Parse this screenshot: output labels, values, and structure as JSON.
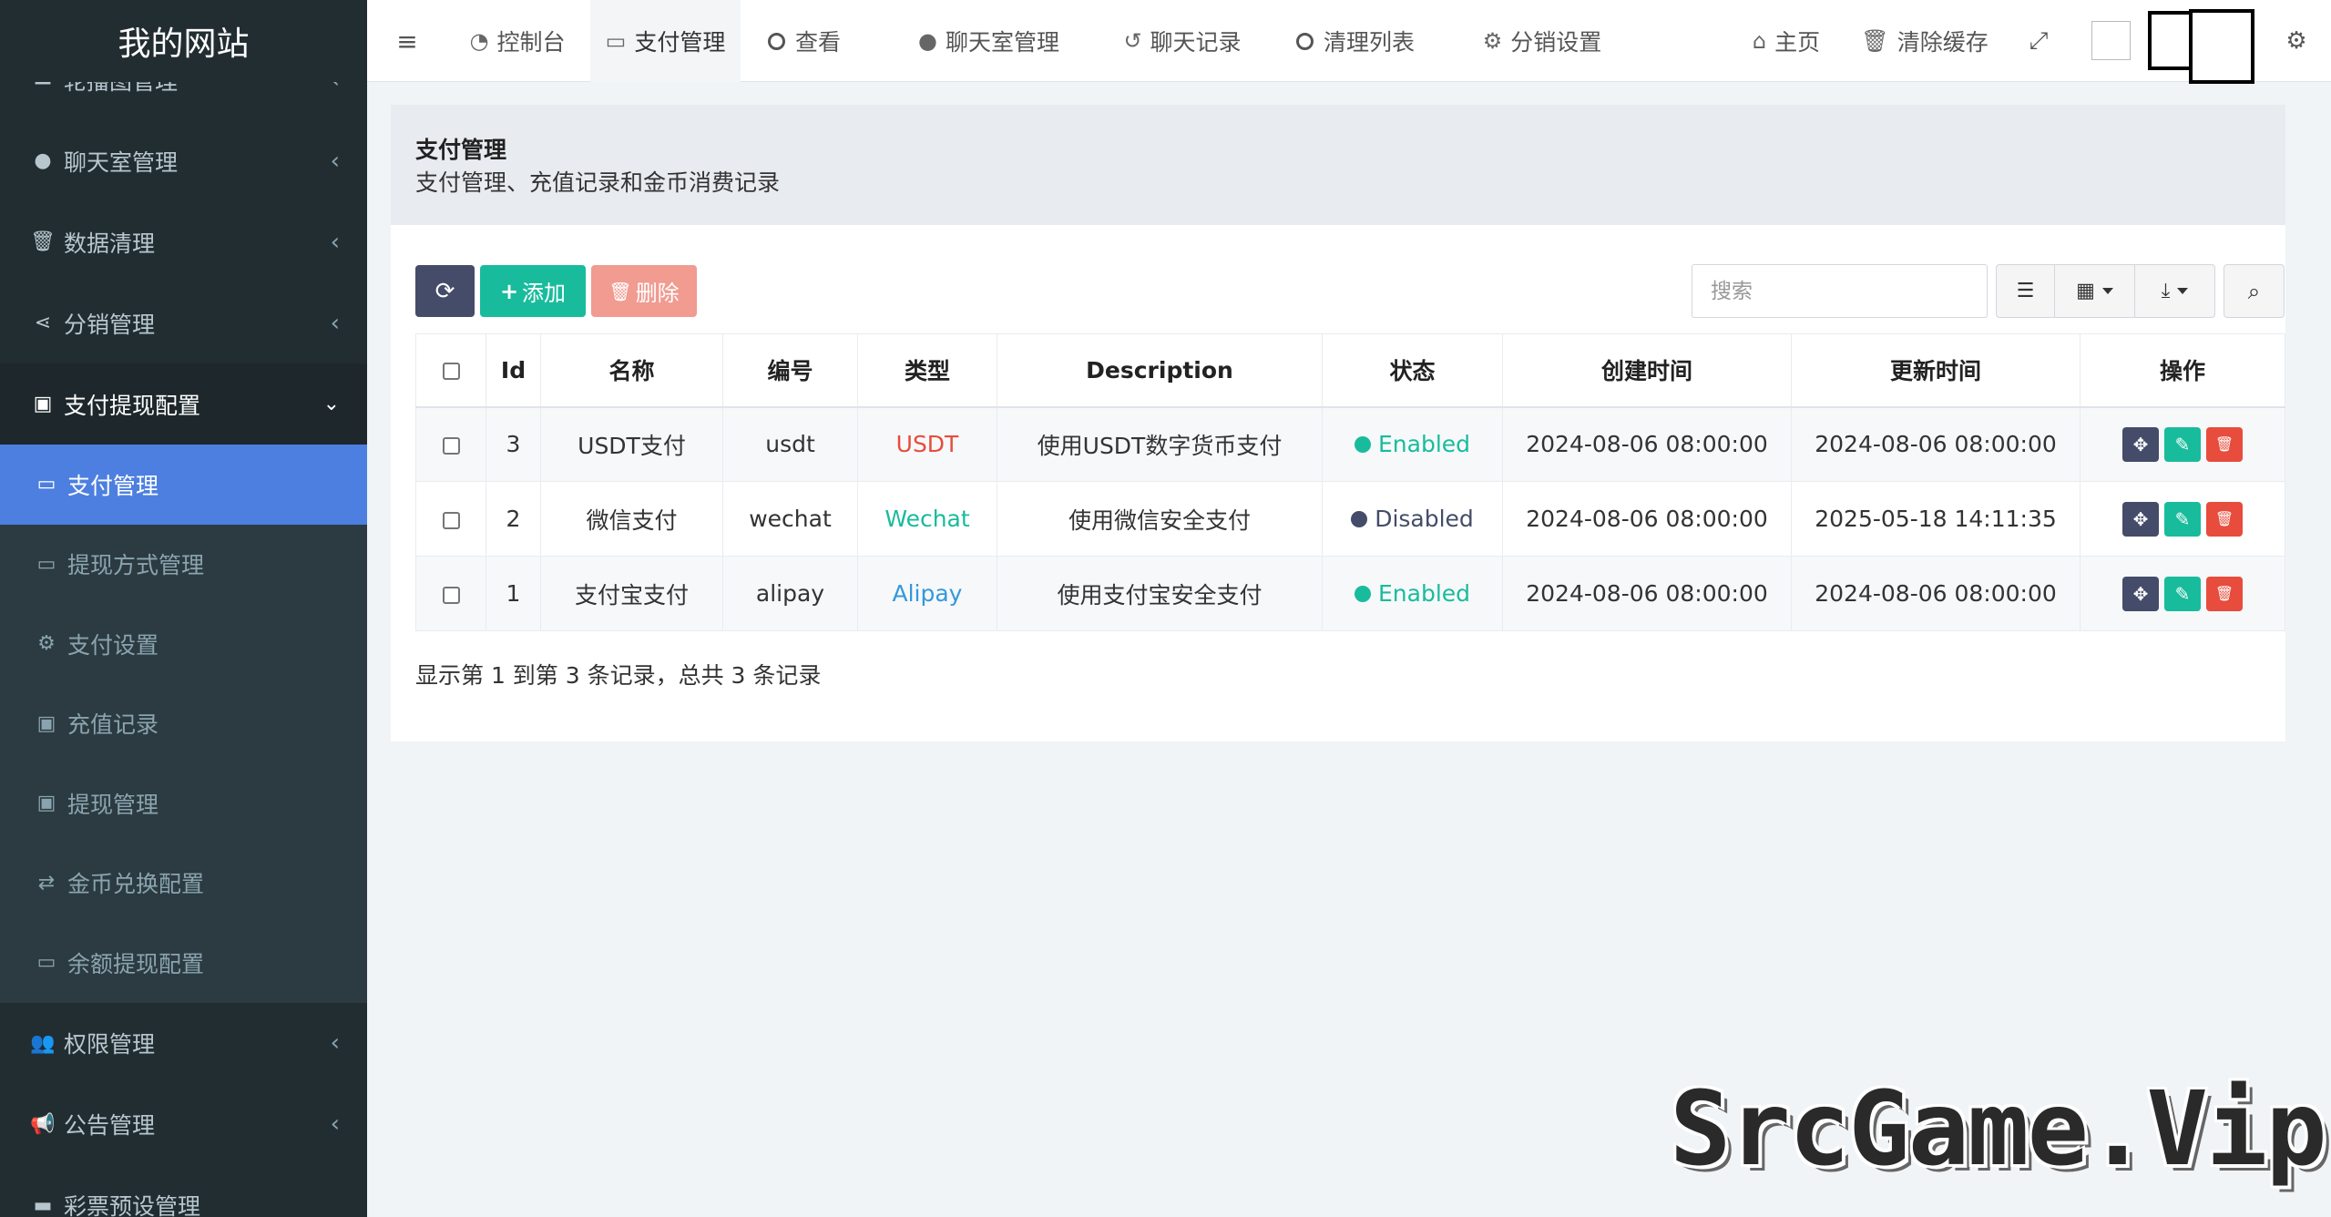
{
  "app": {
    "brand": "我的网站"
  },
  "sidebar": {
    "top_items": [
      {
        "label": "轮播图管理",
        "icon": "image-icon"
      },
      {
        "label": "聊天室管理",
        "icon": "comments-icon"
      },
      {
        "label": "数据清理",
        "icon": "trash-icon"
      },
      {
        "label": "分销管理",
        "icon": "share-icon"
      }
    ],
    "open_group": {
      "label": "支付提现配置",
      "icon": "money-icon",
      "children": [
        {
          "label": "支付管理",
          "icon": "credit-card-icon",
          "active": true
        },
        {
          "label": "提现方式管理",
          "icon": "credit-card-icon"
        },
        {
          "label": "支付设置",
          "icon": "gear-icon"
        },
        {
          "label": "充值记录",
          "icon": "money-icon"
        },
        {
          "label": "提现管理",
          "icon": "money-icon"
        },
        {
          "label": "金币兑换配置",
          "icon": "exchange-icon"
        },
        {
          "label": "余额提现配置",
          "icon": "credit-card-icon"
        }
      ]
    },
    "bottom_items": [
      {
        "label": "权限管理",
        "icon": "users-icon"
      },
      {
        "label": "公告管理",
        "icon": "bullhorn-icon"
      },
      {
        "label": "彩票预设管理",
        "icon": "image-icon"
      }
    ]
  },
  "navbar": {
    "menu_toggle_icon": "bars-icon",
    "tabs": [
      {
        "label": "控制台",
        "icon": "dashboard-icon"
      },
      {
        "label": "支付管理",
        "icon": "credit-card-icon",
        "active": true
      },
      {
        "label": "查看",
        "icon": "circle-icon"
      },
      {
        "label": "聊天室管理",
        "icon": "comments-icon"
      },
      {
        "label": "聊天记录",
        "icon": "history-icon"
      },
      {
        "label": "清理列表",
        "icon": "circle-icon"
      },
      {
        "label": "分销设置",
        "icon": "gears-icon"
      }
    ],
    "home_label": "主页",
    "clear_cache_label": "清除缓存"
  },
  "page": {
    "title": "支付管理",
    "subtitle": "支付管理、充值记录和金币消费记录"
  },
  "toolbar": {
    "add_label": "添加",
    "delete_label": "删除",
    "search_placeholder": "搜索"
  },
  "table": {
    "headers": [
      "Id",
      "名称",
      "编号",
      "类型",
      "Description",
      "状态",
      "创建时间",
      "更新时间",
      "操作"
    ],
    "rows": [
      {
        "id": "3",
        "name": "USDT支付",
        "code": "usdt",
        "type": "USDT",
        "type_color": "#e74c3c",
        "description": "使用USDT数字货币支付",
        "status": "Enabled",
        "status_color": "#18bc9c",
        "created": "2024-08-06 08:00:00",
        "updated": "2024-08-06 08:00:00"
      },
      {
        "id": "2",
        "name": "微信支付",
        "code": "wechat",
        "type": "Wechat",
        "type_color": "#18bc9c",
        "description": "使用微信安全支付",
        "status": "Disabled",
        "status_color": "#444c69",
        "created": "2024-08-06 08:00:00",
        "updated": "2025-05-18 14:11:35"
      },
      {
        "id": "1",
        "name": "支付宝支付",
        "code": "alipay",
        "type": "Alipay",
        "type_color": "#3498db",
        "description": "使用支付宝安全支付",
        "status": "Enabled",
        "status_color": "#18bc9c",
        "created": "2024-08-06 08:00:00",
        "updated": "2024-08-06 08:00:00"
      }
    ]
  },
  "pagination": {
    "info": "显示第 1 到第 3 条记录，总共 3 条记录"
  },
  "watermark": "SrcGame.Vip"
}
